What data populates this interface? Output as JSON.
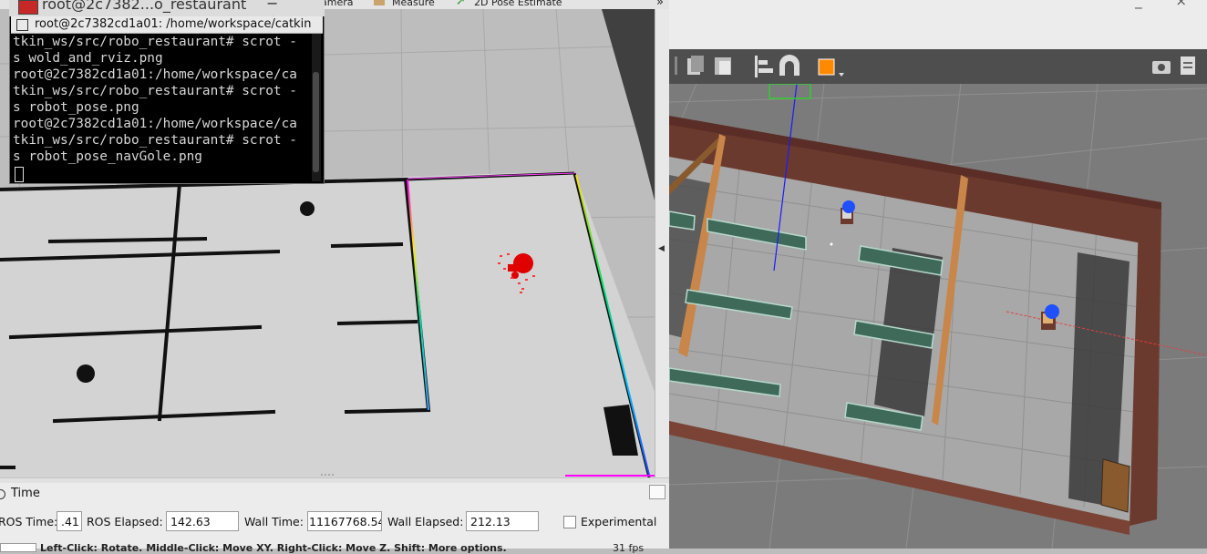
{
  "rviz": {
    "toolbar": {
      "camera_label": "amera",
      "measure_label": "Measure",
      "pose_estimate_label": "2D Pose Estimate",
      "more_label": "»"
    },
    "time_panel": {
      "title": "Time",
      "ros_time_label": "ROS Time:",
      "ros_time_value": ".41",
      "ros_elapsed_label": "ROS Elapsed:",
      "ros_elapsed_value": "142.63",
      "wall_time_label": "Wall Time:",
      "wall_time_value": "11167768.54",
      "wall_elapsed_label": "Wall Elapsed:",
      "wall_elapsed_value": "212.13",
      "experimental_label": "Experimental",
      "hint_text": "Left-Click: Rotate. Middle-Click: Move XY. Right-Click: Move Z. Shift: More options.",
      "fps": "31 fps"
    }
  },
  "terminal": {
    "title": "root@2c7382...o_restaurant",
    "tab_title": "root@2c7382cd1a01: /home/workspace/catkin",
    "lines": [
      "tkin_ws/src/robo_restaurant# scrot -",
      "s wold_and_rviz.png",
      "root@2c7382cd1a01:/home/workspace/ca",
      "tkin_ws/src/robo_restaurant# scrot -",
      "s robot_pose.png",
      "root@2c7382cd1a01:/home/workspace/ca",
      "tkin_ws/src/robo_restaurant# scrot -",
      "s robot_pose_navGole.png"
    ]
  },
  "gazebo": {
    "window_controls": "_ ×"
  },
  "colors": {
    "map_background": "#bfbfbf",
    "map_free": "#d4d4d4",
    "wall": "#6b3a2e",
    "inner_wall": "#c8864a",
    "table": "#3f6a5a",
    "robot_red": "#e00000",
    "robot_blue": "#1f4fff"
  }
}
